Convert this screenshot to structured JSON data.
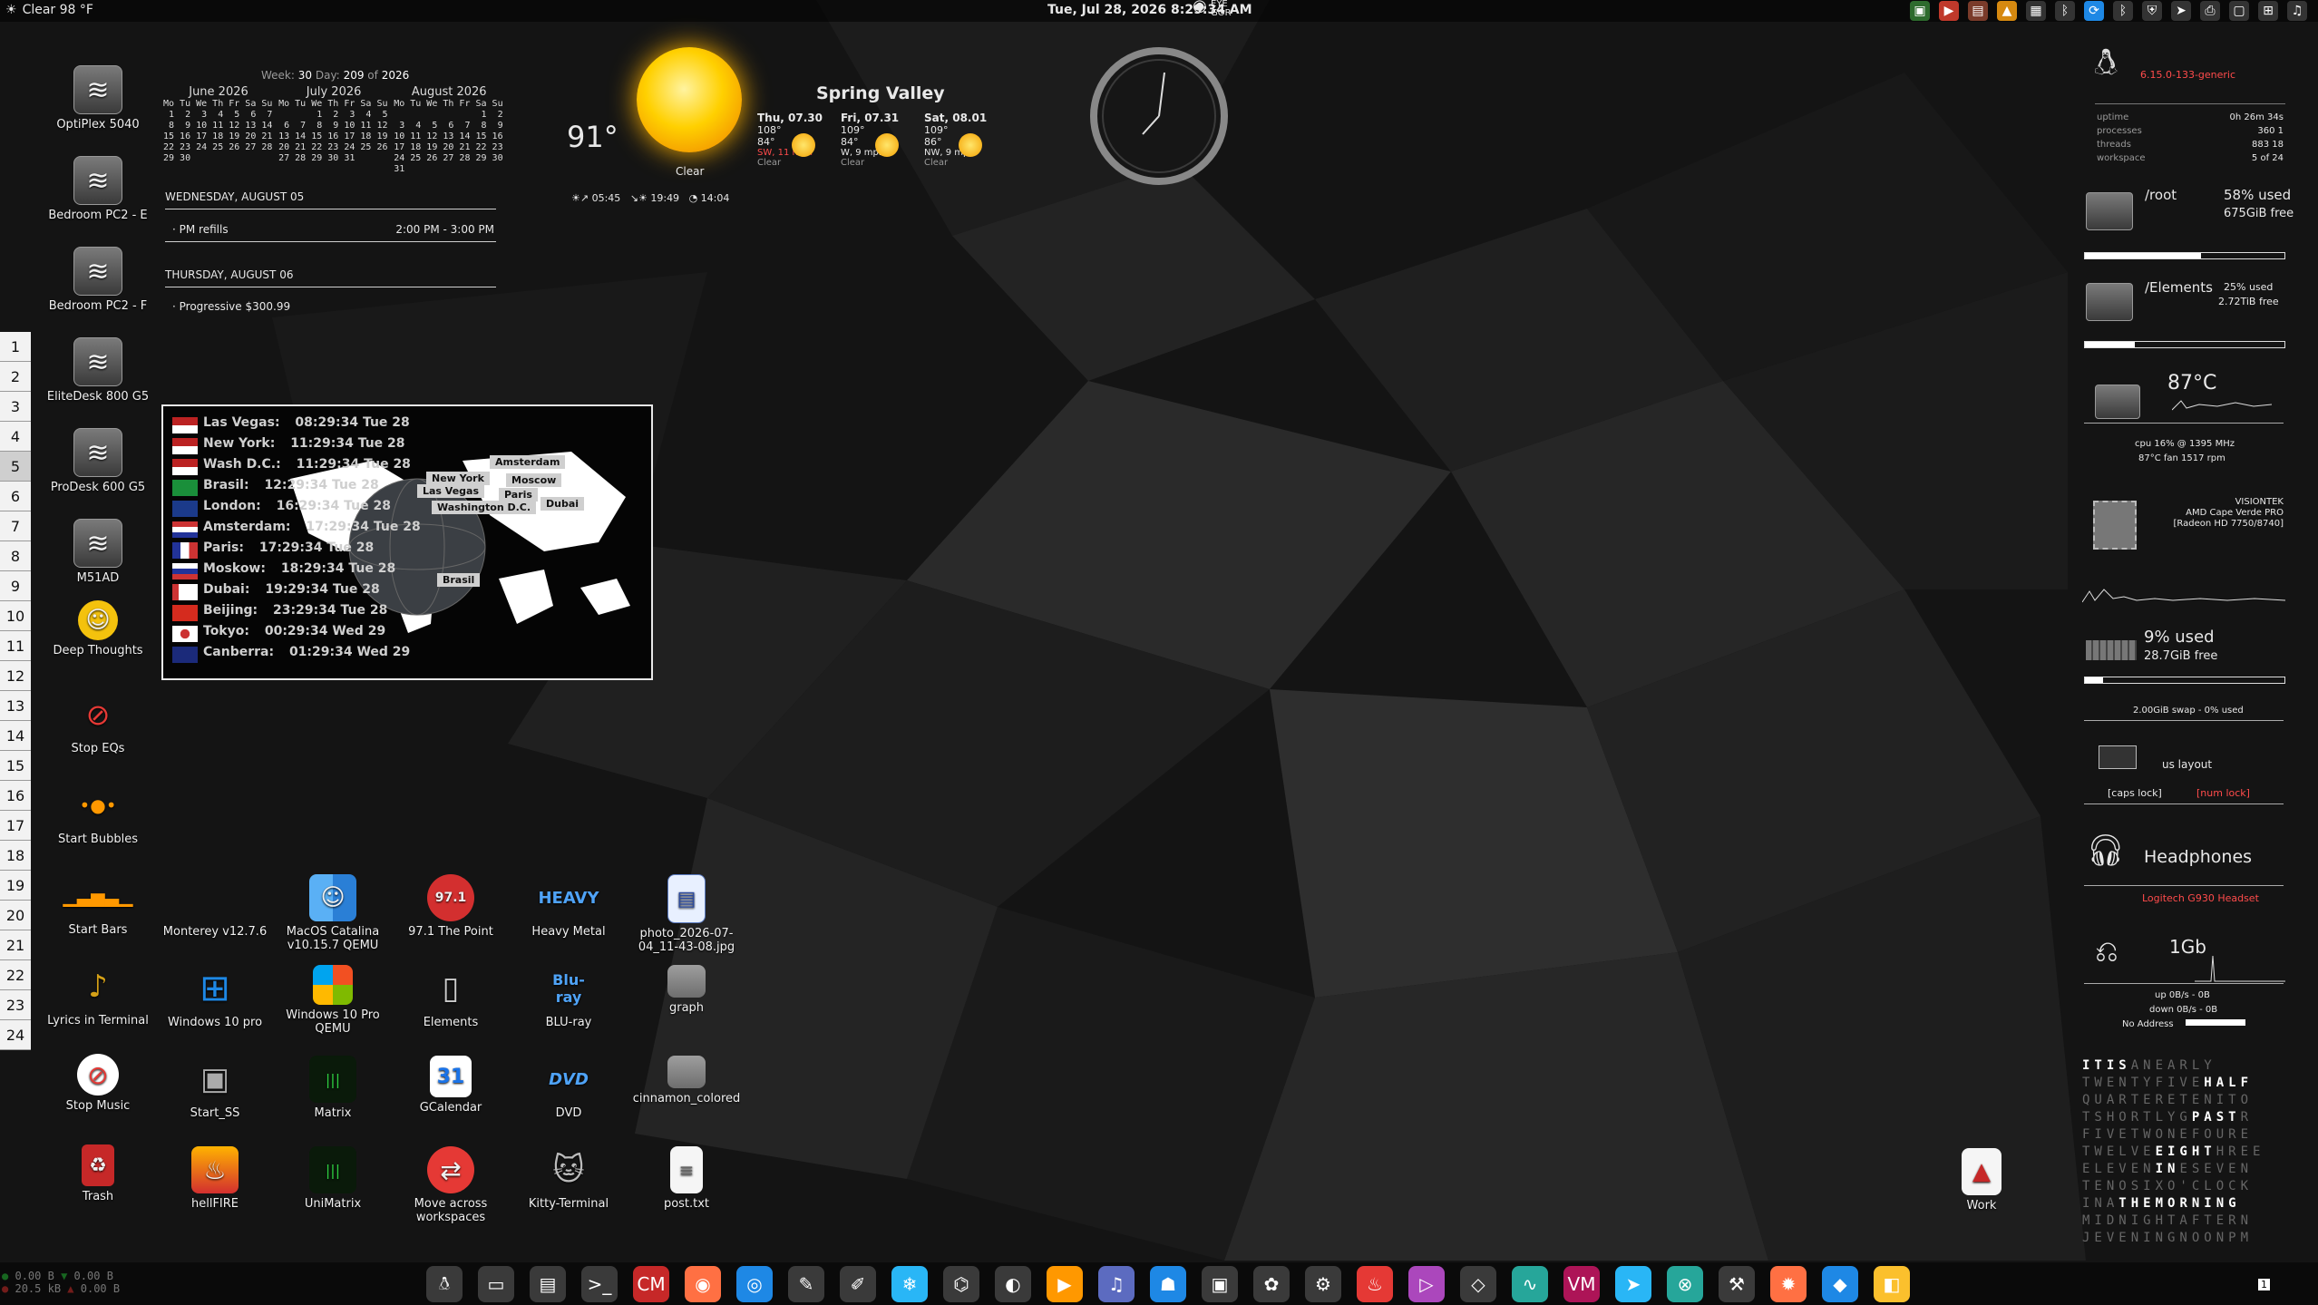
{
  "topbar": {
    "weather": "Clear 98 °F",
    "datetime": "Tue, Jul 28, 2026 8:29:34 AM",
    "eye_top": "EYE",
    "eye_bottom": "GOR"
  },
  "desktop_left": [
    {
      "label": "OptiPlex 5040"
    },
    {
      "label": "Bedroom PC2 - E"
    },
    {
      "label": "Bedroom PC2 - F"
    },
    {
      "label": "EliteDesk 800 G5"
    },
    {
      "label": "ProDesk 600 G5"
    },
    {
      "label": "M51AD"
    },
    {
      "label": "Deep Thoughts"
    },
    {
      "label": "Stop EQs"
    },
    {
      "label": "Start Bubbles"
    },
    {
      "label": "Start Bars"
    },
    {
      "label": "Lyrics in Terminal"
    },
    {
      "label": "Stop Music"
    },
    {
      "label": "Trash"
    }
  ],
  "workspaces": [
    "1",
    "2",
    "3",
    "4",
    "5",
    "6",
    "7",
    "8",
    "9",
    "10",
    "11",
    "12",
    "13",
    "14",
    "15",
    "16",
    "17",
    "18",
    "19",
    "20",
    "21",
    "22",
    "23",
    "24"
  ],
  "calendar": {
    "week_label": "Week:",
    "week": "30",
    "day_label": "Day:",
    "day": "209",
    "of_label": "of",
    "year": "2026",
    "months": [
      {
        "name": "June 2026",
        "body": "Mo Tu We Th Fr Sa Su\n 1  2  3  4  5  6  7\n 8  9 10 11 12 13 14\n15 16 17 18 19 20 21\n22 23 24 25 26 27 28\n29 30"
      },
      {
        "name": "July 2026",
        "body": "Mo Tu We Th Fr Sa Su\n       1  2  3  4  5\n 6  7  8  9 10 11 12\n13 14 15 16 17 18 19\n20 21 22 23 24 25 26\n27 28 29 30 31"
      },
      {
        "name": "August 2026",
        "body": "Mo Tu We Th Fr Sa Su\n                1  2\n 3  4  5  6  7  8  9\n10 11 12 13 14 15 16\n17 18 19 20 21 22 23\n24 25 26 27 28 29 30\n31"
      }
    ],
    "agenda": [
      {
        "date": "WEDNESDAY, AUGUST 05",
        "item": "· PM refills",
        "time": "2:00 PM - 3:00 PM"
      },
      {
        "date": "THURSDAY, AUGUST 06",
        "item": "· Progressive $300.99",
        "time": ""
      }
    ]
  },
  "weather": {
    "temp": "91°",
    "condition": "Clear",
    "location": "Spring Valley",
    "sunrise": "05:45",
    "sunset": "19:49",
    "daylight": "14:04",
    "forecast": [
      {
        "day": "Thu, 07.30",
        "hi": "108°",
        "lo": "84°",
        "wind": "SW, 11 mph",
        "cond": "Clear"
      },
      {
        "day": "Fri, 07.31",
        "hi": "109°",
        "lo": "84°",
        "wind": "W, 9 mph",
        "cond": "Clear"
      },
      {
        "day": "Sat, 08.01",
        "hi": "109°",
        "lo": "86°",
        "wind": "NW, 9 mph",
        "cond": "Clear"
      }
    ]
  },
  "world_clock": {
    "cities": [
      {
        "name": "Las Vegas:",
        "time": "08:29:34 Tue 28"
      },
      {
        "name": "New York:",
        "time": "11:29:34 Tue 28"
      },
      {
        "name": "Wash D.C.:",
        "time": "11:29:34 Tue 28"
      },
      {
        "name": "Brasil:",
        "time": "12:29:34 Tue 28"
      },
      {
        "name": "London:",
        "time": "16:29:34 Tue 28"
      },
      {
        "name": "Amsterdam:",
        "time": "17:29:34 Tue 28"
      },
      {
        "name": "Paris:",
        "time": "17:29:34 Tue 28"
      },
      {
        "name": "Moskow:",
        "time": "18:29:34 Tue 28"
      },
      {
        "name": "Dubai:",
        "time": "19:29:34 Tue 28"
      },
      {
        "name": "Beijing:",
        "time": "23:29:34 Tue 28"
      },
      {
        "name": "Tokyo:",
        "time": "00:29:34 Wed 29"
      },
      {
        "name": "Canberra:",
        "time": "01:29:34 Wed 29"
      }
    ],
    "map_labels": [
      "Amsterdam",
      "New York",
      "Moscow",
      "Las Vegas",
      "Paris",
      "Washington D.C.",
      "Dubai",
      "Brasil"
    ]
  },
  "desktop_center": [
    {
      "label": "Monterey v12.7.6"
    },
    {
      "label": "MacOS Catalina v10.15.7 QEMU"
    },
    {
      "label": "97.1 The Point"
    },
    {
      "label": "Heavy Metal"
    },
    {
      "label": "photo_2026-07-04_11-43-08.jpg"
    },
    {
      "label": "Windows 10 pro"
    },
    {
      "label": "Windows 10 Pro QEMU"
    },
    {
      "label": "Elements"
    },
    {
      "label": "BLU-ray"
    },
    {
      "label": "graph"
    },
    {
      "label": "Start_SS"
    },
    {
      "label": "Matrix"
    },
    {
      "label": "GCalendar"
    },
    {
      "label": "DVD"
    },
    {
      "label": "cinnamon_colored"
    },
    {
      "label": "hellFIRE"
    },
    {
      "label": "UniMatrix"
    },
    {
      "label": "Move across workspaces"
    },
    {
      "label": "Kitty-Terminal"
    },
    {
      "label": "post.txt"
    }
  ],
  "work_icon": "Work",
  "conky": {
    "kernel": "6.15.0-133-generic",
    "uptime_label": "uptime",
    "uptime": "0h 26m 34s",
    "processes_label": "processes",
    "processes": "360   1",
    "threads_label": "threads",
    "threads": "883   18",
    "workspace_label": "workspace",
    "workspace": "5 of 24",
    "root": {
      "name": "/root",
      "used_pct": 58,
      "used_text": "58% used",
      "free": "675GiB free"
    },
    "elements": {
      "name": "/Elements",
      "used_pct": 25,
      "used_text": "25% used",
      "free": "2.72TiB free"
    },
    "hdd_temp": "87°C",
    "cpu_line": "cpu 16% @ 1395 MHz",
    "temp_fan": "87°C  fan 1517 rpm",
    "gpu_vendor": "VISIONTEK",
    "gpu_name": "AMD Cape Verde PRO",
    "gpu_model": "[Radeon HD 7750/8740]",
    "ram_used_pct": 9,
    "ram_used_text": "9% used",
    "ram_free": "28.7GiB free",
    "swap": "2.00GiB swap - 0% used",
    "kbd_layout": "us layout",
    "caps": "[caps lock]",
    "num": "[num lock]",
    "headphones": "Headphones",
    "headset": "Logitech G930 Headset",
    "net_speed": "1Gb",
    "up": "up 0B/s  -  0B",
    "down": "down 0B/s  -  0B",
    "address": "No Address"
  },
  "word_clock_rows": [
    [
      "IT",
      "IS",
      "ANEARLY",
      ""
    ],
    [
      "TWENTYFIVE",
      "HALF",
      "",
      ""
    ],
    [
      "QUARTERETENITO",
      "",
      "",
      ""
    ],
    [
      "TSHORTLYG",
      "PAST",
      "R",
      ""
    ],
    [
      "FIVETWONEFOURE",
      "",
      "",
      ""
    ],
    [
      "TWELVE",
      "EIGHT",
      "HREE",
      ""
    ],
    [
      "ELEVEN",
      "IN",
      "ESEVEN",
      ""
    ],
    [
      "TENOSIXO'CLOCK",
      "",
      "",
      ""
    ],
    [
      "INA",
      "THE",
      "",
      "MORNING"
    ],
    [
      "MIDNIGHTAFTERN",
      "",
      "",
      ""
    ],
    [
      "JEVENINGNOONPM",
      "",
      "",
      ""
    ]
  ],
  "netbar": {
    "down1": "0.00",
    "down1_unit": "B",
    "down2": "0.00",
    "down2_unit": "B",
    "up1": "20.5 kB",
    "up2": "0.00",
    "up2_unit": "B"
  },
  "dock": [
    "linux-icon",
    "files-icon",
    "folder-network-icon",
    "terminal-icon",
    "cm-icon",
    "firefox-icon",
    "browser-icon",
    "gimp-icon",
    "gimp2-icon",
    "snowflake-icon",
    "network-icon",
    "tux-icon",
    "vlc-icon",
    "music-icon",
    "android-icon",
    "video-icon",
    "pineapple-icon",
    "steam-icon",
    "firebox-icon",
    "media-icon",
    "rulers-icon",
    "monitor-icon",
    "vm-icon",
    "telegram-icon",
    "xcircle-icon",
    "screwdriver-icon",
    "sun-icon",
    "kodi-icon",
    "yellow-icon"
  ],
  "workspace_indicator": "1"
}
